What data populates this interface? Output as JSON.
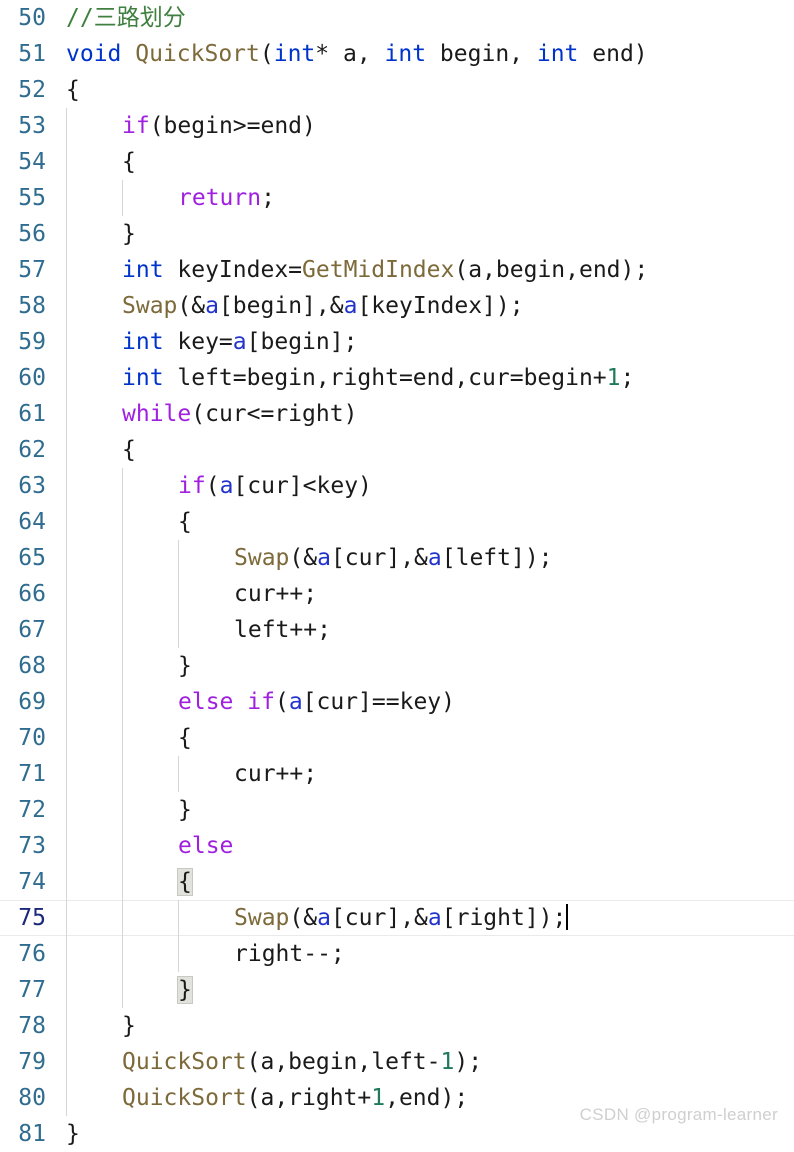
{
  "editor": {
    "language": "cpp",
    "first_line_number": 50,
    "active_line_number": 75,
    "caret_line": 75,
    "caret_at_end_of_line": true,
    "colors": {
      "background": "#ffffff",
      "text": "#1a1a1a",
      "line_number": "#2f6c8f",
      "line_number_active": "#1b2a78",
      "comment": "#3f7f3f",
      "keyword_type": "#0033cc",
      "keyword_control": "#a020e0",
      "function": "#7d6a3a",
      "parameter": "#2233cc",
      "number": "#1f7a5a",
      "indent_guide": "#d6d6d6",
      "active_line_border": "#eaeaea",
      "brace_match_bg": "#e2e2dc",
      "watermark": "#cfcfcf"
    },
    "lines": [
      {
        "n": "50",
        "indent": 0,
        "guides": 0,
        "text": "//三路划分",
        "tokens": [
          {
            "t": "//三路划分",
            "c": "t-cmt"
          }
        ]
      },
      {
        "n": "51",
        "indent": 0,
        "guides": 0,
        "text": "void QuickSort(int* a, int begin, int end)",
        "tokens": [
          {
            "t": "void",
            "c": "t-kw"
          },
          {
            "t": " ",
            "c": "t-pln"
          },
          {
            "t": "QuickSort",
            "c": "t-fn"
          },
          {
            "t": "(",
            "c": "t-pln"
          },
          {
            "t": "int",
            "c": "t-kw"
          },
          {
            "t": "* a, ",
            "c": "t-pln"
          },
          {
            "t": "int",
            "c": "t-kw"
          },
          {
            "t": " begin, ",
            "c": "t-pln"
          },
          {
            "t": "int",
            "c": "t-kw"
          },
          {
            "t": " end)",
            "c": "t-pln"
          }
        ]
      },
      {
        "n": "52",
        "indent": 0,
        "guides": 0,
        "text": "{",
        "tokens": [
          {
            "t": "{",
            "c": "t-pln"
          }
        ]
      },
      {
        "n": "53",
        "indent": 1,
        "guides": 1,
        "text": "if(begin>=end)",
        "tokens": [
          {
            "t": "if",
            "c": "t-ctl"
          },
          {
            "t": "(begin>=end)",
            "c": "t-pln"
          }
        ]
      },
      {
        "n": "54",
        "indent": 1,
        "guides": 1,
        "text": "{",
        "tokens": [
          {
            "t": "{",
            "c": "t-pln"
          }
        ]
      },
      {
        "n": "55",
        "indent": 2,
        "guides": 2,
        "text": "return;",
        "tokens": [
          {
            "t": "return",
            "c": "t-ctl"
          },
          {
            "t": ";",
            "c": "t-pln"
          }
        ]
      },
      {
        "n": "56",
        "indent": 1,
        "guides": 1,
        "text": "}",
        "tokens": [
          {
            "t": "}",
            "c": "t-pln"
          }
        ]
      },
      {
        "n": "57",
        "indent": 1,
        "guides": 1,
        "text": "int keyIndex=GetMidIndex(a,begin,end);",
        "tokens": [
          {
            "t": "int",
            "c": "t-kw"
          },
          {
            "t": " keyIndex=",
            "c": "t-pln"
          },
          {
            "t": "GetMidIndex",
            "c": "t-fn"
          },
          {
            "t": "(a,begin,end);",
            "c": "t-pln"
          }
        ]
      },
      {
        "n": "58",
        "indent": 1,
        "guides": 1,
        "text": "Swap(&a[begin],&a[keyIndex]);",
        "tokens": [
          {
            "t": "Swap",
            "c": "t-fn"
          },
          {
            "t": "(&",
            "c": "t-pln"
          },
          {
            "t": "a",
            "c": "t-var"
          },
          {
            "t": "[begin],&",
            "c": "t-pln"
          },
          {
            "t": "a",
            "c": "t-var"
          },
          {
            "t": "[keyIndex]);",
            "c": "t-pln"
          }
        ]
      },
      {
        "n": "59",
        "indent": 1,
        "guides": 1,
        "text": "int key=a[begin];",
        "tokens": [
          {
            "t": "int",
            "c": "t-kw"
          },
          {
            "t": " key=",
            "c": "t-pln"
          },
          {
            "t": "a",
            "c": "t-var"
          },
          {
            "t": "[begin];",
            "c": "t-pln"
          }
        ]
      },
      {
        "n": "60",
        "indent": 1,
        "guides": 1,
        "text": "int left=begin,right=end,cur=begin+1;",
        "tokens": [
          {
            "t": "int",
            "c": "t-kw"
          },
          {
            "t": " left=begin,right=end,cur=begin+",
            "c": "t-pln"
          },
          {
            "t": "1",
            "c": "t-num"
          },
          {
            "t": ";",
            "c": "t-pln"
          }
        ]
      },
      {
        "n": "61",
        "indent": 1,
        "guides": 1,
        "text": "while(cur<=right)",
        "tokens": [
          {
            "t": "while",
            "c": "t-ctl"
          },
          {
            "t": "(cur<=right)",
            "c": "t-pln"
          }
        ]
      },
      {
        "n": "62",
        "indent": 1,
        "guides": 1,
        "text": "{",
        "tokens": [
          {
            "t": "{",
            "c": "t-pln"
          }
        ]
      },
      {
        "n": "63",
        "indent": 2,
        "guides": 2,
        "text": "if(a[cur]<key)",
        "tokens": [
          {
            "t": "if",
            "c": "t-ctl"
          },
          {
            "t": "(",
            "c": "t-pln"
          },
          {
            "t": "a",
            "c": "t-var"
          },
          {
            "t": "[cur]<key)",
            "c": "t-pln"
          }
        ]
      },
      {
        "n": "64",
        "indent": 2,
        "guides": 2,
        "text": "{",
        "tokens": [
          {
            "t": "{",
            "c": "t-pln"
          }
        ]
      },
      {
        "n": "65",
        "indent": 3,
        "guides": 3,
        "text": "Swap(&a[cur],&a[left]);",
        "tokens": [
          {
            "t": "Swap",
            "c": "t-fn"
          },
          {
            "t": "(&",
            "c": "t-pln"
          },
          {
            "t": "a",
            "c": "t-var"
          },
          {
            "t": "[cur],&",
            "c": "t-pln"
          },
          {
            "t": "a",
            "c": "t-var"
          },
          {
            "t": "[left]);",
            "c": "t-pln"
          }
        ]
      },
      {
        "n": "66",
        "indent": 3,
        "guides": 3,
        "text": "cur++;",
        "tokens": [
          {
            "t": "cur++;",
            "c": "t-pln"
          }
        ]
      },
      {
        "n": "67",
        "indent": 3,
        "guides": 3,
        "text": "left++;",
        "tokens": [
          {
            "t": "left++;",
            "c": "t-pln"
          }
        ]
      },
      {
        "n": "68",
        "indent": 2,
        "guides": 2,
        "text": "}",
        "tokens": [
          {
            "t": "}",
            "c": "t-pln"
          }
        ]
      },
      {
        "n": "69",
        "indent": 2,
        "guides": 2,
        "text": "else if(a[cur]==key)",
        "tokens": [
          {
            "t": "else",
            "c": "t-ctl"
          },
          {
            "t": " ",
            "c": "t-pln"
          },
          {
            "t": "if",
            "c": "t-ctl"
          },
          {
            "t": "(",
            "c": "t-pln"
          },
          {
            "t": "a",
            "c": "t-var"
          },
          {
            "t": "[cur]==key)",
            "c": "t-pln"
          }
        ]
      },
      {
        "n": "70",
        "indent": 2,
        "guides": 2,
        "text": "{",
        "tokens": [
          {
            "t": "{",
            "c": "t-pln"
          }
        ]
      },
      {
        "n": "71",
        "indent": 3,
        "guides": 3,
        "text": "cur++;",
        "tokens": [
          {
            "t": "cur++;",
            "c": "t-pln"
          }
        ]
      },
      {
        "n": "72",
        "indent": 2,
        "guides": 2,
        "text": "}",
        "tokens": [
          {
            "t": "}",
            "c": "t-pln"
          }
        ]
      },
      {
        "n": "73",
        "indent": 2,
        "guides": 2,
        "text": "else",
        "tokens": [
          {
            "t": "else",
            "c": "t-ctl"
          }
        ]
      },
      {
        "n": "74",
        "indent": 2,
        "guides": 2,
        "text": "{",
        "brace_match": true,
        "tokens": [
          {
            "t": "{",
            "c": "t-pln",
            "brace": true
          }
        ]
      },
      {
        "n": "75",
        "indent": 3,
        "guides": 3,
        "text": "Swap(&a[cur],&a[right]);",
        "active": true,
        "caret": true,
        "tokens": [
          {
            "t": "Swap",
            "c": "t-fn"
          },
          {
            "t": "(&",
            "c": "t-pln"
          },
          {
            "t": "a",
            "c": "t-var"
          },
          {
            "t": "[cur],&",
            "c": "t-pln"
          },
          {
            "t": "a",
            "c": "t-var"
          },
          {
            "t": "[right]);",
            "c": "t-pln"
          }
        ]
      },
      {
        "n": "76",
        "indent": 3,
        "guides": 3,
        "text": "right--;",
        "tokens": [
          {
            "t": "right--;",
            "c": "t-pln"
          }
        ]
      },
      {
        "n": "77",
        "indent": 2,
        "guides": 2,
        "text": "}",
        "brace_match": true,
        "tokens": [
          {
            "t": "}",
            "c": "t-pln",
            "brace": true
          }
        ]
      },
      {
        "n": "78",
        "indent": 1,
        "guides": 1,
        "text": "}",
        "tokens": [
          {
            "t": "}",
            "c": "t-pln"
          }
        ]
      },
      {
        "n": "79",
        "indent": 1,
        "guides": 1,
        "text": "QuickSort(a,begin,left-1);",
        "tokens": [
          {
            "t": "QuickSort",
            "c": "t-fn"
          },
          {
            "t": "(a,begin,left-",
            "c": "t-pln"
          },
          {
            "t": "1",
            "c": "t-num"
          },
          {
            "t": ");",
            "c": "t-pln"
          }
        ]
      },
      {
        "n": "80",
        "indent": 1,
        "guides": 1,
        "text": "QuickSort(a,right+1,end);",
        "tokens": [
          {
            "t": "QuickSort",
            "c": "t-fn"
          },
          {
            "t": "(a,right+",
            "c": "t-pln"
          },
          {
            "t": "1",
            "c": "t-num"
          },
          {
            "t": ",end);",
            "c": "t-pln"
          }
        ]
      },
      {
        "n": "81",
        "indent": 0,
        "guides": 0,
        "text": "}",
        "tokens": [
          {
            "t": "}",
            "c": "t-pln"
          }
        ]
      }
    ]
  },
  "watermark": {
    "text": "CSDN @program-learner"
  }
}
